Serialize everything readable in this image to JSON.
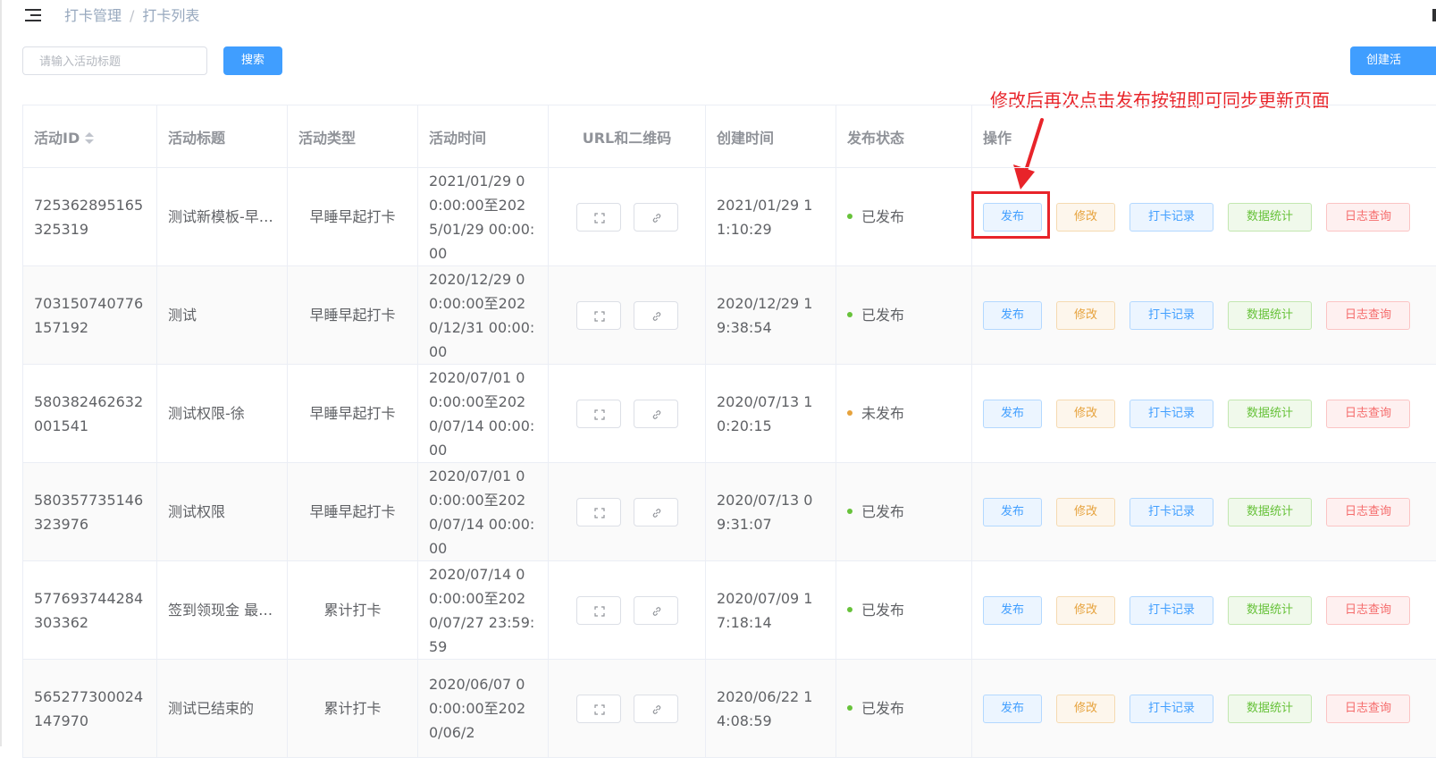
{
  "breadcrumb": {
    "items": [
      "打卡管理",
      "打卡列表"
    ],
    "separator": "/"
  },
  "search": {
    "placeholder": "请输入活动标题",
    "value": "",
    "button_label": "搜索"
  },
  "create_button_label": "创建活",
  "annotation": {
    "text": "修改后再次点击发布按钮即可同步更新页面",
    "color": "#e8242a"
  },
  "table": {
    "headers": [
      "活动ID",
      "活动标题",
      "活动类型",
      "活动时间",
      "URL和二维码",
      "创建时间",
      "发布状态",
      "操作"
    ],
    "rows": [
      {
        "id": "725362895165325319",
        "title": "测试新模板-早…",
        "type": "早睡早起打卡",
        "time": "2021/01/29 00:00:00至2025/01/29 00:00:00",
        "created": "2021/01/29 11:10:29",
        "status": "已发布",
        "status_color": "#67c23a"
      },
      {
        "id": "703150740776157192",
        "title": "测试",
        "type": "早睡早起打卡",
        "time": "2020/12/29 00:00:00至2020/12/31 00:00:00",
        "created": "2020/12/29 19:38:54",
        "status": "已发布",
        "status_color": "#67c23a"
      },
      {
        "id": "580382462632001541",
        "title": "测试权限-徐",
        "type": "早睡早起打卡",
        "time": "2020/07/01 00:00:00至2020/07/14 00:00:00",
        "created": "2020/07/13 10:20:15",
        "status": "未发布",
        "status_color": "#e6a23c"
      },
      {
        "id": "580357735146323976",
        "title": "测试权限",
        "type": "早睡早起打卡",
        "time": "2020/07/01 00:00:00至2020/07/14 00:00:00",
        "created": "2020/07/13 09:31:07",
        "status": "已发布",
        "status_color": "#67c23a"
      },
      {
        "id": "577693744284303362",
        "title": "签到领现金 最…",
        "type": "累计打卡",
        "time": "2020/07/14 00:00:00至2020/07/27 23:59:59",
        "created": "2020/07/09 17:18:14",
        "status": "已发布",
        "status_color": "#67c23a"
      },
      {
        "id": "565277300024147970",
        "title": "测试已结束的",
        "type": "累计打卡",
        "time": "2020/06/07 00:00:00至2020/06/2",
        "created": "2020/06/22 14:08:59",
        "status": "已发布",
        "status_color": "#67c23a"
      }
    ],
    "actions": {
      "publish": "发布",
      "edit": "修改",
      "records": "打卡记录",
      "stats": "数据统计",
      "logs": "日志查询"
    }
  },
  "colors": {
    "primary": "#409eff",
    "warning": "#e6a23c",
    "success": "#67c23a",
    "danger": "#f56c6c"
  }
}
